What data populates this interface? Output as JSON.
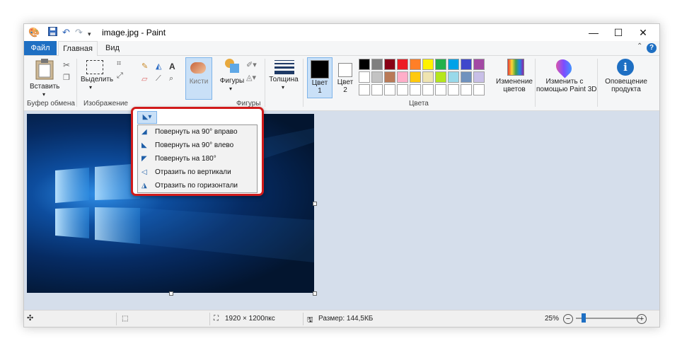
{
  "window": {
    "title": "image.jpg - Paint"
  },
  "quick_access": {
    "icons": [
      "paint-app-icon",
      "save-icon",
      "undo-icon",
      "redo-icon",
      "customize-dropdown-icon"
    ]
  },
  "tabs": {
    "file": "Файл",
    "home": "Главная",
    "view": "Вид"
  },
  "ribbon": {
    "paste": "Вставить",
    "clipboard_group": "Буфер обмена",
    "select": "Выделить",
    "image_group": "Изображение",
    "brushes": "Кисти",
    "shapes": "Фигуры",
    "shapes_group": "Фигуры",
    "thickness": "Толщина",
    "color1_line1": "Цвет",
    "color1_line2": "1",
    "color2_line1": "Цвет",
    "color2_line2": "2",
    "colors_group": "Цвета",
    "edit_colors_line1": "Изменение",
    "edit_colors_line2": "цветов",
    "paint3d_line1": "Изменить с",
    "paint3d_line2": "помощью Paint 3D",
    "notify_line1": "Оповещение",
    "notify_line2": "продукта"
  },
  "palette": {
    "row1": [
      "#000000",
      "#7f7f7f",
      "#880015",
      "#ed1c24",
      "#ff7f27",
      "#fff200",
      "#22b14c",
      "#00a2e8",
      "#3f48cc",
      "#a349a4"
    ],
    "row2": [
      "#ffffff",
      "#c3c3c3",
      "#b97a57",
      "#ffaec9",
      "#ffc90e",
      "#efe4b0",
      "#b5e61d",
      "#99d9ea",
      "#7092be",
      "#c8bfe7"
    ],
    "row3": [
      "#ffffff",
      "#ffffff",
      "#ffffff",
      "#ffffff",
      "#ffffff",
      "#ffffff",
      "#ffffff",
      "#ffffff",
      "#ffffff",
      "#ffffff"
    ],
    "color1": "#000000",
    "color2": "#ffffff"
  },
  "rotate_menu": {
    "items": [
      {
        "label": "Повернуть на 90° вправо",
        "icon": "rotate-right-icon"
      },
      {
        "label": "Повернуть на 90° влево",
        "icon": "rotate-left-icon"
      },
      {
        "label": "Повернуть на 180°",
        "icon": "rotate-180-icon"
      },
      {
        "label": "Отразить по вертикали",
        "icon": "flip-vertical-icon"
      },
      {
        "label": "Отразить по горизонтали",
        "icon": "flip-horizontal-icon"
      }
    ]
  },
  "status": {
    "dimensions": "1920 × 1200пкс",
    "size": "Размер: 144,5КБ",
    "zoom": "25%"
  },
  "accent_colors": {
    "file_tab": "#1e6fc3",
    "highlight": "#d11b1b",
    "workspace": "#d5deeb"
  }
}
